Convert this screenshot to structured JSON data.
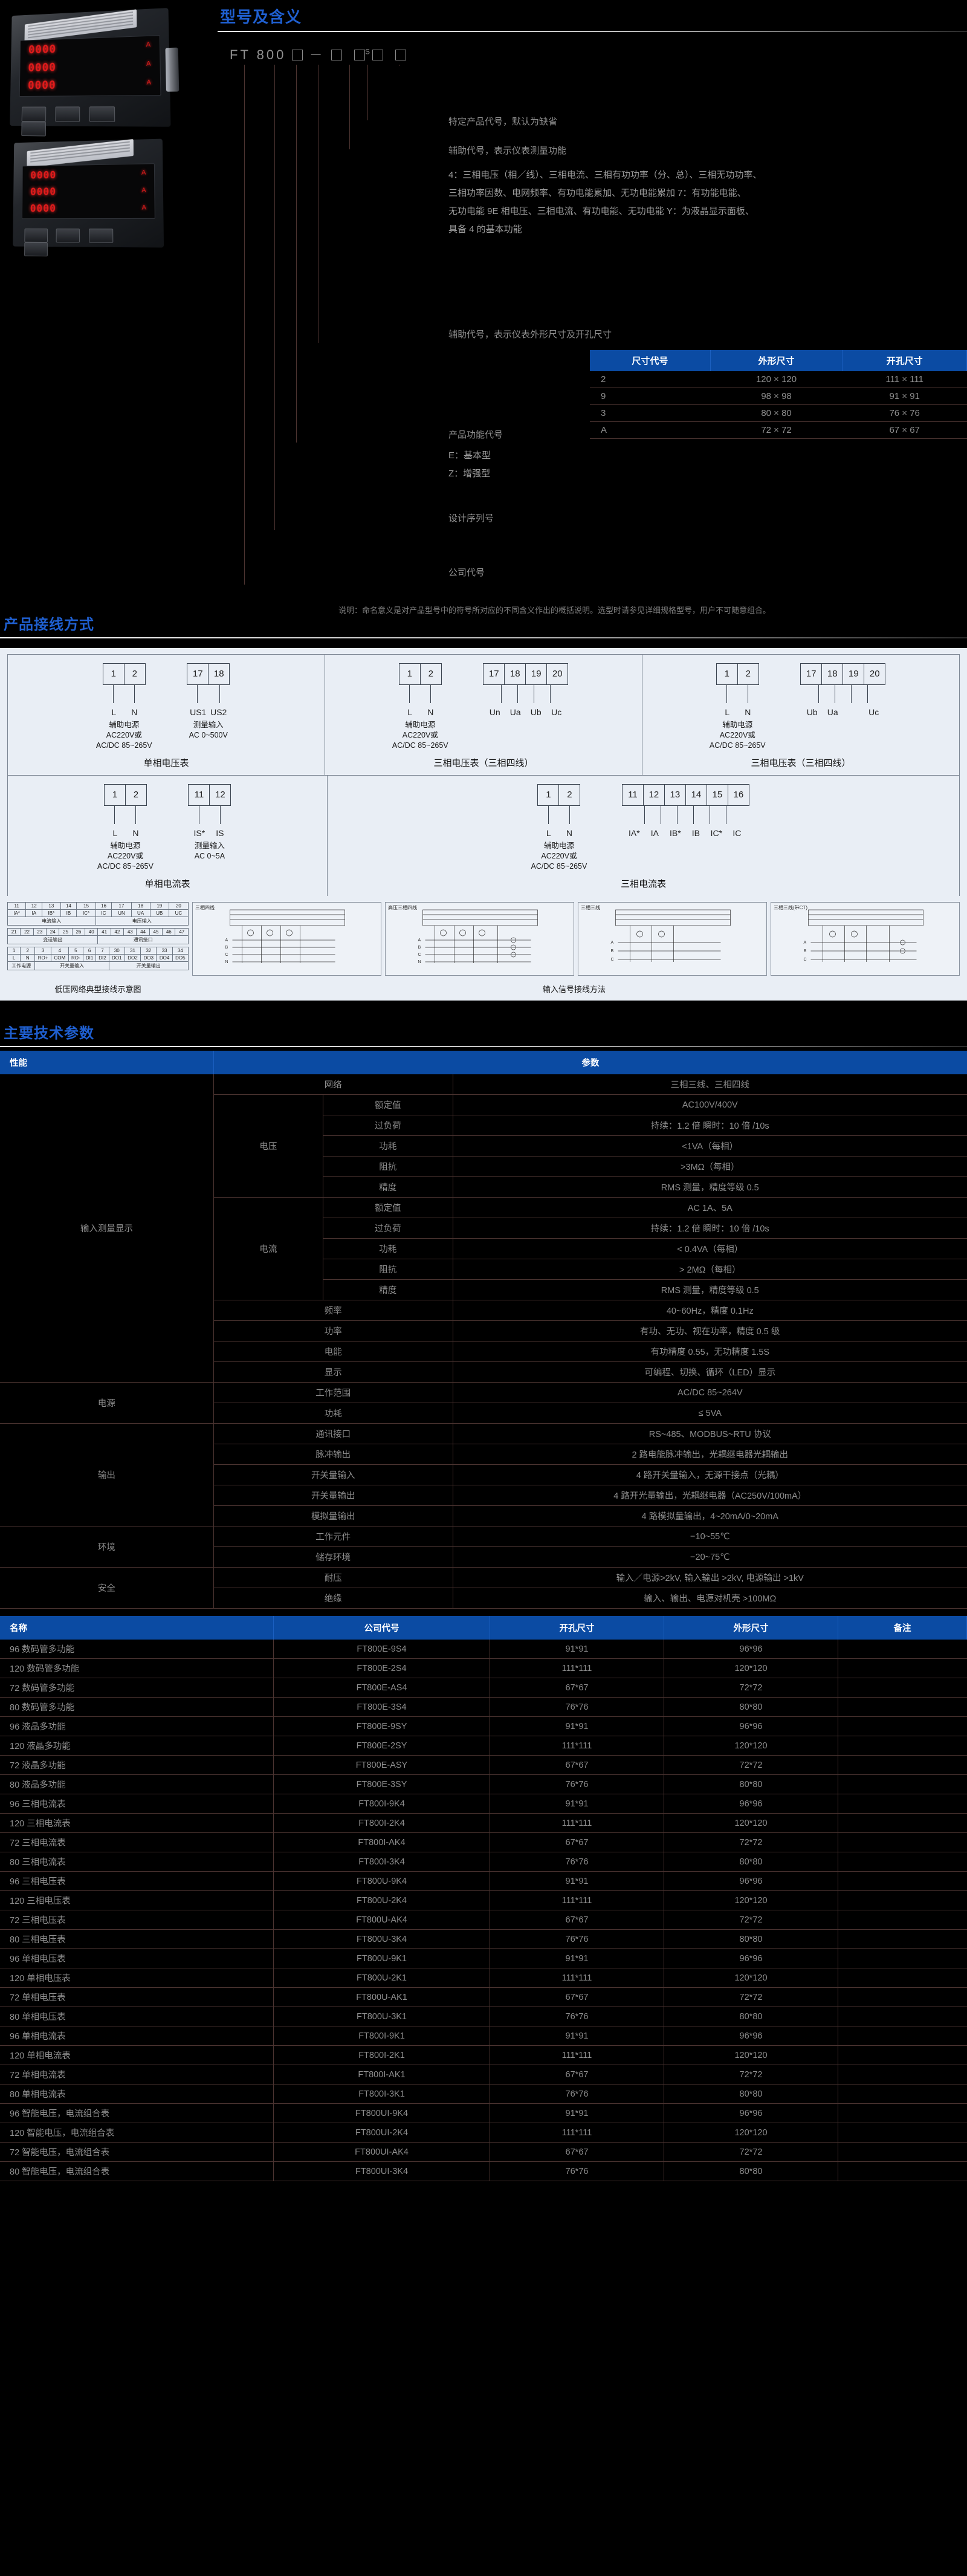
{
  "sections": {
    "model": "型号及含义",
    "wiring": "产品接线方式",
    "spec": "主要技术参数"
  },
  "model_diagram": {
    "code_prefix": "FT 800",
    "code_separator": "－",
    "code_s": "S",
    "annotations": [
      "特定产品代号，默认为缺省",
      "辅助代号，表示仪表测量功能",
      "辅助代号，表示仪表外形尺寸及开孔尺寸",
      "产品功能代号",
      "设计序列号",
      "公司代号"
    ],
    "function_detail": [
      "4：三相电压（相／线）、三相电流、三相有功功率（分、总）、三相无功功率、",
      "三相功率因数、电网频率、有功电能累加、无功电能累加 7：有功能电能、",
      "无功电能 9E 相电压、三相电流、有功电能、无功电能 Y：为液晶显示面板、",
      "具备 4 的基本功能"
    ],
    "product_types": [
      "E：基本型",
      "Z：增强型"
    ],
    "note": "说明：命名意义是对产品型号中的符号所对应的不同含义作出的概括说明。选型时请参见详细规格型号，用户不可随意组合。",
    "size_table": {
      "headers": [
        "尺寸代号",
        "外形尺寸",
        "开孔尺寸"
      ],
      "rows": [
        [
          "2",
          "120 × 120",
          "111 × 111"
        ],
        [
          "9",
          "98 × 98",
          "91 × 91"
        ],
        [
          "3",
          "80 × 80",
          "76 × 76"
        ],
        [
          "A",
          "72 × 72",
          "67 × 67"
        ]
      ]
    }
  },
  "wiring": {
    "cards": [
      {
        "title": "单相电压表",
        "groups": [
          {
            "terminals": [
              "1",
              "2"
            ],
            "pins": [
              "L",
              "N"
            ],
            "sub": [
              "辅助电源",
              "AC220V或",
              "AC/DC 85~265V"
            ]
          },
          {
            "terminals": [
              "17",
              "18"
            ],
            "pins": [
              "US1",
              "US2"
            ],
            "sub": [
              "测量输入",
              "AC 0~500V"
            ]
          }
        ]
      },
      {
        "title": "三相电压表（三相四线）",
        "groups": [
          {
            "terminals": [
              "1",
              "2"
            ],
            "pins": [
              "L",
              "N"
            ],
            "sub": [
              "辅助电源",
              "AC220V或",
              "AC/DC 85~265V"
            ]
          },
          {
            "terminals": [
              "17",
              "18",
              "19",
              "20"
            ],
            "pins": [
              "Un",
              "Ua",
              "Ub",
              "Uc"
            ],
            "sub": [
              "",
              ""
            ]
          }
        ]
      },
      {
        "title": "三相电压表（三相四线）",
        "groups": [
          {
            "terminals": [
              "1",
              "2"
            ],
            "pins": [
              "L",
              "N"
            ],
            "sub": [
              "辅助电源",
              "AC220V或",
              "AC/DC 85~265V"
            ]
          },
          {
            "terminals": [
              "17",
              "18",
              "19",
              "20"
            ],
            "pins": [
              "Ub",
              "Ua",
              "",
              "Uc"
            ],
            "sub": [
              "",
              ""
            ]
          }
        ]
      },
      {
        "title": "单相电流表",
        "groups": [
          {
            "terminals": [
              "1",
              "2"
            ],
            "pins": [
              "L",
              "N"
            ],
            "sub": [
              "辅助电源",
              "AC220V或",
              "AC/DC 85~265V"
            ]
          },
          {
            "terminals": [
              "11",
              "12"
            ],
            "pins": [
              "IS*",
              "IS"
            ],
            "sub": [
              "测量输入",
              "AC 0~5A"
            ]
          }
        ]
      },
      {
        "title": "三相电流表",
        "groups": [
          {
            "terminals": [
              "1",
              "2"
            ],
            "pins": [
              "L",
              "N"
            ],
            "sub": [
              "辅助电源",
              "AC220V或",
              "AC/DC 85~265V"
            ]
          },
          {
            "terminals": [
              "11",
              "12",
              "13",
              "14",
              "15",
              "16"
            ],
            "pins": [
              "IA*",
              "IA",
              "IB*",
              "IB",
              "IC*",
              "IC"
            ],
            "sub": [
              "",
              ""
            ]
          }
        ]
      }
    ],
    "bottom_caption_left": "低压网络典型接线示意图",
    "bottom_caption_right": "输入信号接线方法",
    "mini_tables": [
      {
        "cells": [
          "11",
          "12",
          "13",
          "14",
          "15",
          "16",
          "17",
          "18",
          "19",
          "20"
        ]
      },
      {
        "cells": [
          "IA*",
          "IA",
          "IB*",
          "IB",
          "IC*",
          "IC",
          "UN",
          "UA",
          "UB",
          "UC"
        ]
      },
      {
        "cells": [
          "电流输入",
          "",
          "",
          "",
          "",
          "电压输入",
          "",
          "",
          "",
          ""
        ]
      },
      {
        "cells": [
          "21",
          "22",
          "23",
          "24",
          "25",
          "26",
          "40",
          "41",
          "42",
          "43",
          "44",
          "45",
          "46",
          "47"
        ]
      },
      {
        "cells": [
          "变送输出",
          "",
          "",
          "",
          "",
          "",
          "",
          "通讯接口",
          "",
          "",
          "",
          "",
          "",
          ""
        ]
      },
      {
        "cells": [
          "1",
          "2",
          "3",
          "4",
          "5",
          "6",
          "7",
          "30",
          "31",
          "32",
          "33",
          "34"
        ]
      },
      {
        "cells": [
          "L",
          "N",
          "RO+",
          "COM",
          "RO-",
          "DI1",
          "DI2",
          "DO1",
          "DO2",
          "DO3",
          "DO4",
          "DO5"
        ]
      },
      {
        "cells": [
          "工作电源",
          "",
          "开关量输入",
          "",
          "",
          "",
          "",
          "开关量输出",
          "",
          "",
          "",
          ""
        ]
      }
    ],
    "schem_labels": [
      "三相四线",
      "高压三相四线",
      "三相三线",
      "三相三线(带CT)"
    ]
  },
  "spec_table": {
    "headers": [
      "性能",
      "",
      "",
      "参数"
    ],
    "groups": [
      {
        "name": "输入测量显示",
        "rows": [
          {
            "sub": "",
            "item": "网络",
            "value": "三相三线、三相四线",
            "sub_rowspan": 0
          },
          {
            "sub": "电压",
            "item": "额定值",
            "value": "AC100V/400V"
          },
          {
            "sub": "",
            "item": "过负荷",
            "value": "持续：1.2 倍  瞬时：10 倍 /10s"
          },
          {
            "sub": "",
            "item": "功耗",
            "value": "<1VA（每相）"
          },
          {
            "sub": "",
            "item": "阻抗",
            "value": ">3MΩ（每相）"
          },
          {
            "sub": "",
            "item": "精度",
            "value": "RMS 测量，精度等级 0.5"
          },
          {
            "sub": "电流",
            "item": "额定值",
            "value": "AC 1A、5A"
          },
          {
            "sub": "",
            "item": "过负荷",
            "value": "持续：1.2 倍  瞬时：10 倍 /10s"
          },
          {
            "sub": "",
            "item": "功耗",
            "value": "< 0.4VA（每相）"
          },
          {
            "sub": "",
            "item": "阻抗",
            "value": "> 2MΩ（每相）"
          },
          {
            "sub": "",
            "item": "精度",
            "value": "RMS 测量，精度等级 0.5"
          },
          {
            "sub": "",
            "item": "频率",
            "value": "40~60Hz，精度 0.1Hz",
            "wide": true
          },
          {
            "sub": "",
            "item": "功率",
            "value": "有功、无功、视在功率，精度 0.5 级",
            "wide": true
          },
          {
            "sub": "",
            "item": "电能",
            "value": "有功精度 0.55，无功精度 1.5S",
            "wide": true
          },
          {
            "sub": "",
            "item": "显示",
            "value": "可编程、切换、循环（LED）显示",
            "wide": true
          }
        ]
      },
      {
        "name": "电源",
        "rows": [
          {
            "item": "工作范围",
            "value": "AC/DC 85~264V",
            "wide": true
          },
          {
            "item": "功耗",
            "value": "≤ 5VA",
            "wide": true
          }
        ]
      },
      {
        "name": "输出",
        "rows": [
          {
            "item": "通讯接口",
            "value": "RS~485、MODBUS~RTU 协议",
            "wide": true
          },
          {
            "item": "脉冲输出",
            "value": "2 路电能脉冲输出，光耦继电器光耦输出",
            "wide": true
          },
          {
            "item": "开关量输入",
            "value": "4 路开关量输入，无源干接点（光耦）",
            "wide": true
          },
          {
            "item": "开关量输出",
            "value": "4 路开光量输出，光耦继电器（AC250V/100mA）",
            "wide": true
          },
          {
            "item": "模拟量输出",
            "value": "4 路模拟量输出，4~20mA/0~20mA",
            "wide": true
          }
        ]
      },
      {
        "name": "环境",
        "rows": [
          {
            "item": "工作元件",
            "value": "−10~55℃",
            "wide": true
          },
          {
            "item": "储存环境",
            "value": "−20~75℃",
            "wide": true
          }
        ]
      },
      {
        "name": "安全",
        "rows": [
          {
            "item": "耐压",
            "value": "输入／电源>2kV, 输入输出 >2kV, 电源输出 >1kV",
            "wide": true
          },
          {
            "item": "绝缘",
            "value": "输入、输出、电源对机壳 >100MΩ",
            "wide": true
          }
        ]
      }
    ]
  },
  "model_list": {
    "headers": [
      "名称",
      "公司代号",
      "开孔尺寸",
      "外形尺寸",
      "备注"
    ],
    "rows": [
      [
        "96 数码管多功能",
        "FT800E-9S4",
        "91*91",
        "96*96",
        ""
      ],
      [
        "120 数码管多功能",
        "FT800E-2S4",
        "111*111",
        "120*120",
        ""
      ],
      [
        "72 数码管多功能",
        "FT800E-AS4",
        "67*67",
        "72*72",
        ""
      ],
      [
        "80 数码管多功能",
        "FT800E-3S4",
        "76*76",
        "80*80",
        ""
      ],
      [
        "96 液晶多功能",
        "FT800E-9SY",
        "91*91",
        "96*96",
        ""
      ],
      [
        "120 液晶多功能",
        "FT800E-2SY",
        "111*111",
        "120*120",
        ""
      ],
      [
        "72 液晶多功能",
        "FT800E-ASY",
        "67*67",
        "72*72",
        ""
      ],
      [
        "80 液晶多功能",
        "FT800E-3SY",
        "76*76",
        "80*80",
        ""
      ],
      [
        "96 三相电流表",
        "FT800I-9K4",
        "91*91",
        "96*96",
        ""
      ],
      [
        "120 三相电流表",
        "FT800I-2K4",
        "111*111",
        "120*120",
        ""
      ],
      [
        "72 三相电流表",
        "FT800I-AK4",
        "67*67",
        "72*72",
        ""
      ],
      [
        "80 三相电流表",
        "FT800I-3K4",
        "76*76",
        "80*80",
        ""
      ],
      [
        "96 三相电压表",
        "FT800U-9K4",
        "91*91",
        "96*96",
        ""
      ],
      [
        "120 三相电压表",
        "FT800U-2K4",
        "111*111",
        "120*120",
        ""
      ],
      [
        "72 三相电压表",
        "FT800U-AK4",
        "67*67",
        "72*72",
        ""
      ],
      [
        "80 三相电压表",
        "FT800U-3K4",
        "76*76",
        "80*80",
        ""
      ],
      [
        "96 单相电压表",
        "FT800U-9K1",
        "91*91",
        "96*96",
        ""
      ],
      [
        "120 单相电压表",
        "FT800U-2K1",
        "111*111",
        "120*120",
        ""
      ],
      [
        "72 单相电压表",
        "FT800U-AK1",
        "67*67",
        "72*72",
        ""
      ],
      [
        "80 单相电压表",
        "FT800U-3K1",
        "76*76",
        "80*80",
        ""
      ],
      [
        "96 单相电流表",
        "FT800I-9K1",
        "91*91",
        "96*96",
        ""
      ],
      [
        "120 单相电流表",
        "FT800I-2K1",
        "111*111",
        "120*120",
        ""
      ],
      [
        "72 单相电流表",
        "FT800I-AK1",
        "67*67",
        "72*72",
        ""
      ],
      [
        "80 单相电流表",
        "FT800I-3K1",
        "76*76",
        "80*80",
        ""
      ],
      [
        "96 智能电压，电流组合表",
        "FT800UI-9K4",
        "91*91",
        "96*96",
        ""
      ],
      [
        "120 智能电压，电流组合表",
        "FT800UI-2K4",
        "111*111",
        "120*120",
        ""
      ],
      [
        "72 智能电压，电流组合表",
        "FT800UI-AK4",
        "67*67",
        "72*72",
        ""
      ],
      [
        "80 智能电压，电流组合表",
        "FT800UI-3K4",
        "76*76",
        "80*80",
        ""
      ]
    ]
  },
  "meter_display": {
    "rows": [
      "0000",
      "0000",
      "0000"
    ],
    "units": [
      "A",
      "A",
      "A"
    ]
  },
  "colors": {
    "accent": "#0b4ba3",
    "heading": "#1f5fd0",
    "text": "#8d8d8d",
    "segment": "#e11b1b"
  }
}
